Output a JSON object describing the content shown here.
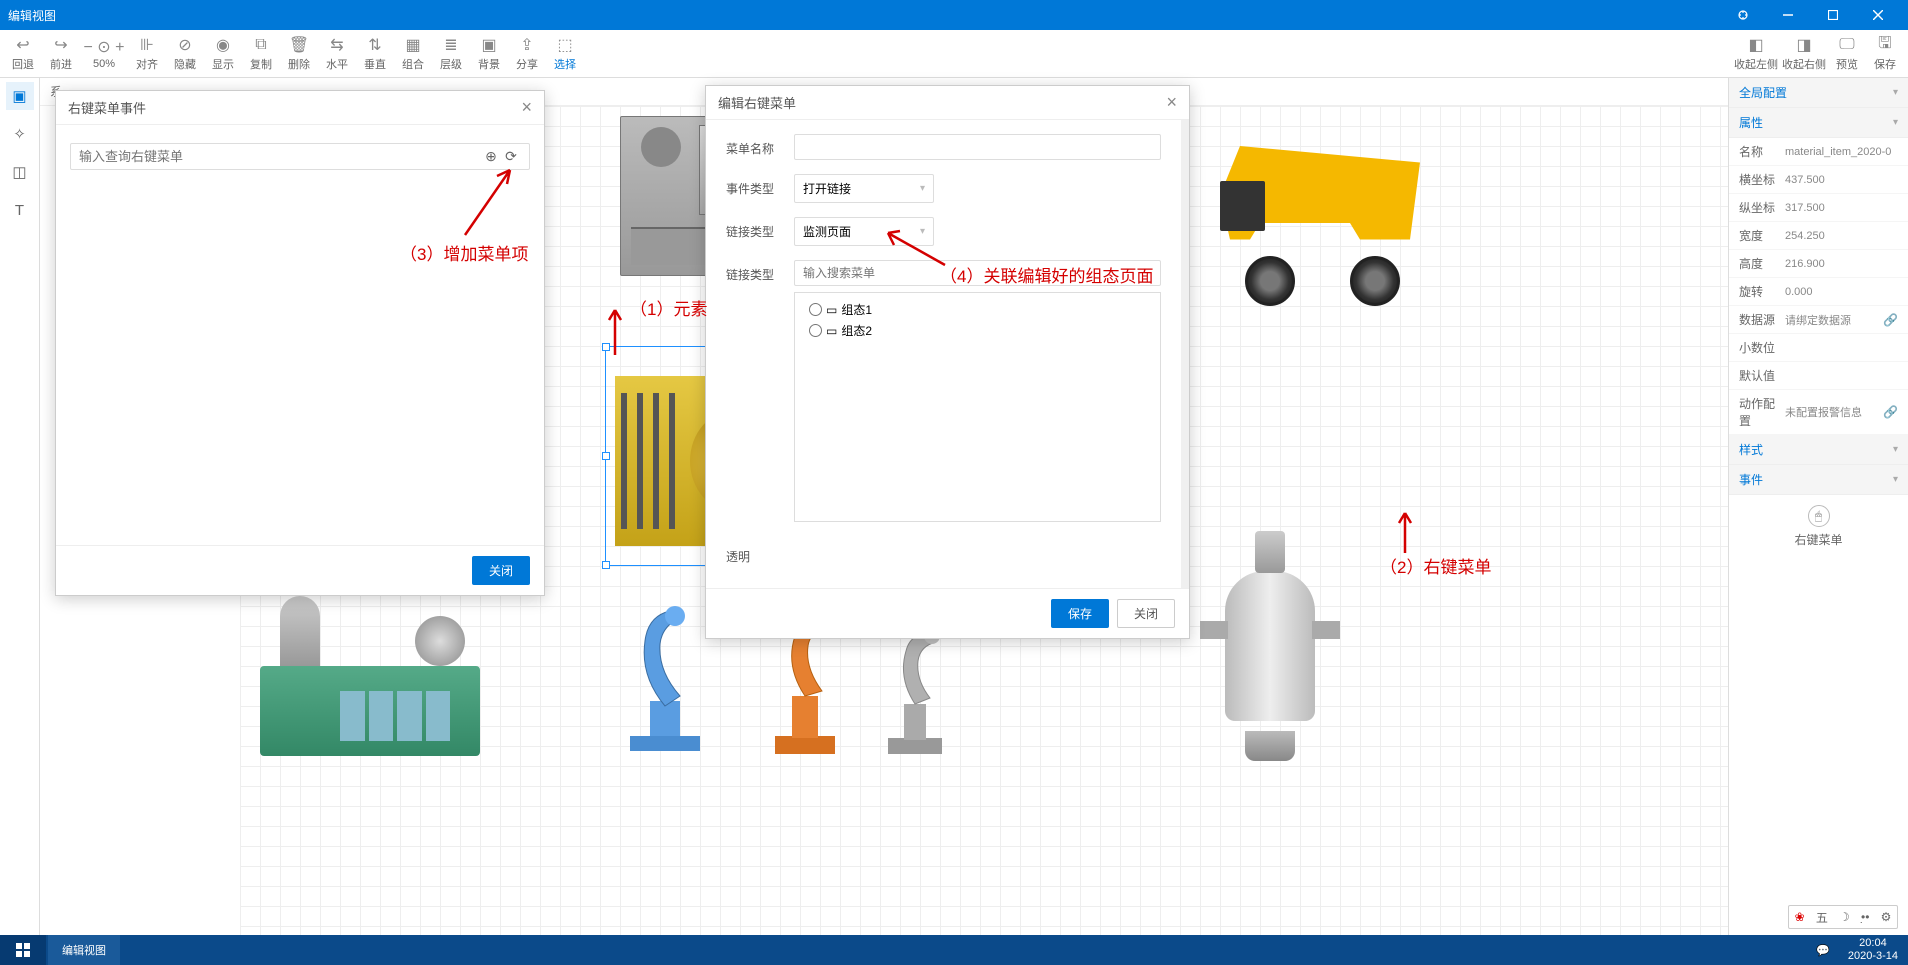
{
  "window": {
    "title": "编辑视图"
  },
  "toolbar": {
    "left": [
      {
        "id": "undo",
        "label": "回退"
      },
      {
        "id": "redo",
        "label": "前进"
      },
      {
        "id": "zoom",
        "label": "50%"
      },
      {
        "id": "align",
        "label": "对齐"
      },
      {
        "id": "hide",
        "label": "隐藏"
      },
      {
        "id": "show",
        "label": "显示"
      },
      {
        "id": "copy",
        "label": "复制"
      },
      {
        "id": "delete",
        "label": "删除"
      },
      {
        "id": "horiz",
        "label": "水平"
      },
      {
        "id": "vert",
        "label": "垂直"
      },
      {
        "id": "group",
        "label": "组合"
      },
      {
        "id": "layer",
        "label": "层级"
      },
      {
        "id": "bg",
        "label": "背景"
      },
      {
        "id": "share",
        "label": "分享"
      },
      {
        "id": "select",
        "label": "选择"
      }
    ],
    "right": [
      {
        "id": "collapse-left",
        "label": "收起左侧"
      },
      {
        "id": "collapse-right",
        "label": "收起右侧"
      },
      {
        "id": "preview",
        "label": "预览"
      },
      {
        "id": "save",
        "label": "保存"
      }
    ]
  },
  "canvas": {
    "head_label": "系…"
  },
  "right_panel": {
    "sections": {
      "global": "全局配置",
      "props": "属性",
      "style": "样式",
      "events": "事件"
    },
    "props": {
      "name_label": "名称",
      "name_value": "material_item_2020-0",
      "x_label": "横坐标",
      "x_value": "437.500",
      "y_label": "纵坐标",
      "y_value": "317.500",
      "w_label": "宽度",
      "w_value": "254.250",
      "h_label": "高度",
      "h_value": "216.900",
      "rot_label": "旋转",
      "rot_value": "0.000",
      "ds_label": "数据源",
      "ds_value": "请绑定数据源",
      "dec_label": "小数位",
      "dec_value": "",
      "def_label": "默认值",
      "def_value": "",
      "act_label": "动作配置",
      "act_value": "未配置报警信息"
    },
    "event_btn_label": "右键菜单"
  },
  "dialog1": {
    "title": "右键菜单事件",
    "search_placeholder": "输入查询右键菜单",
    "close_btn": "关闭"
  },
  "dialog2": {
    "title": "编辑右键菜单",
    "rows": {
      "name_label": "菜单名称",
      "event_type_label": "事件类型",
      "event_type_value": "打开链接",
      "link_type_label": "链接类型",
      "link_type_value": "监测页面",
      "link_target_label": "链接类型",
      "search_placeholder": "输入搜索菜单",
      "tree_items": [
        "组态1",
        "组态2"
      ],
      "opacity_label": "透明"
    },
    "save_btn": "保存",
    "close_btn": "关闭"
  },
  "annotations": {
    "a1": "（1）元素",
    "a2": "（2）右键菜单",
    "a3": "（3）增加菜单项",
    "a4": "（4）关联编辑好的组态页面"
  },
  "taskbar": {
    "app": "编辑视图",
    "time": "20:04",
    "date": "2020-3-14"
  },
  "tray": {
    "ime": "五"
  }
}
